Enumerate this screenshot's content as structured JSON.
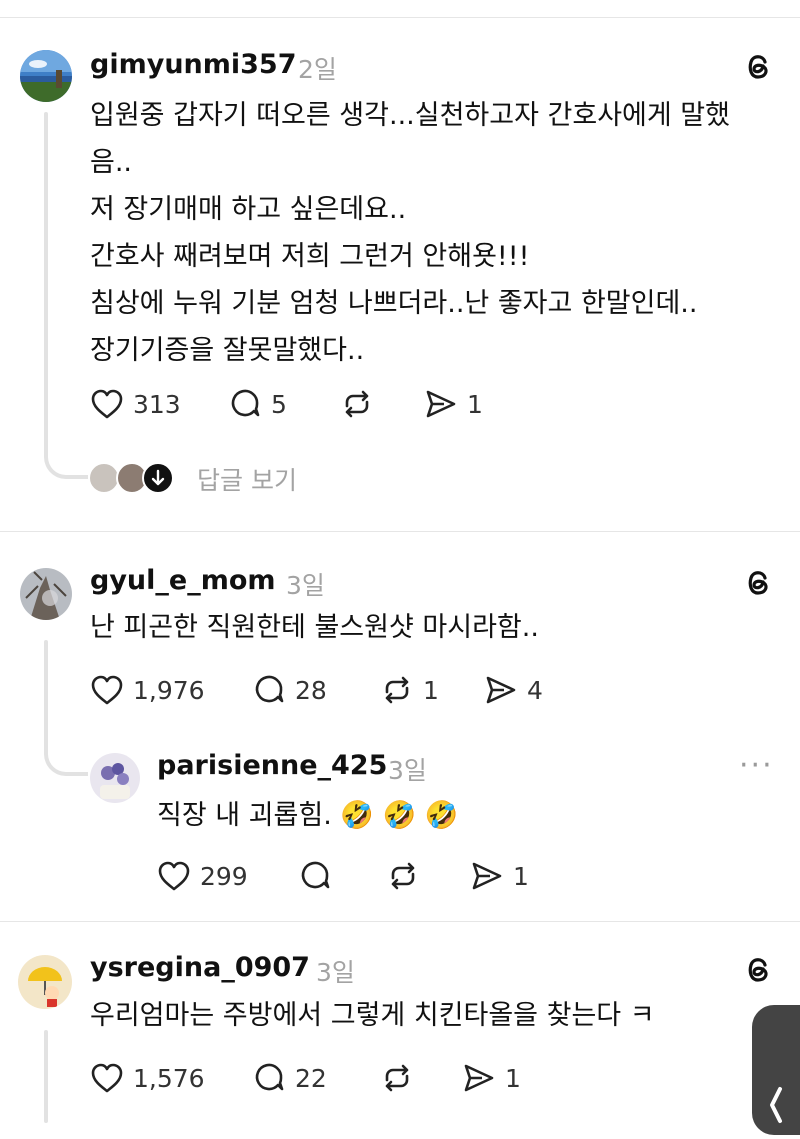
{
  "posts": [
    {
      "username": "gimyunmi357",
      "time": "2일",
      "lines": [
        "입원중 갑자기 떠오른 생각...실천하고자 간호사에게 말했",
        "음..",
        "저 장기매매 하고 싶은데요..",
        "간호사 째려보며 저희 그런거 안해욧!!!",
        "침상에 누워 기분 엄청 나쁘더라..난 좋자고 한말인데..",
        "장기기증을 잘못말했다.."
      ],
      "likes": "313",
      "comments": "5",
      "shares": "1",
      "view_replies": "답글 보기"
    },
    {
      "username": "gyul_e_mom",
      "time": "3일",
      "lines": [
        "난 피곤한 직원한테 불스원샷 마시라함.."
      ],
      "likes": "1,976",
      "comments": "28",
      "reposts": "1",
      "shares": "4"
    },
    {
      "username": "parisienne_425",
      "time": "3일",
      "lines": [
        "직장 내 괴롭힘."
      ],
      "emojis": [
        "🤣",
        "🤣",
        "🤣"
      ],
      "likes": "299",
      "shares": "1",
      "more": "···"
    },
    {
      "username": "ysregina_0907",
      "time": "3일",
      "lines": [
        "우리엄마는 주방에서 그렇게 치킨타올을 찾는다 ㅋ"
      ],
      "likes": "1,576",
      "comments": "22",
      "shares": "1"
    }
  ],
  "icons": {
    "threads": "threads-logo-icon",
    "like": "heart-icon",
    "comment": "comment-bubble-icon",
    "repost": "repost-icon",
    "share": "send-icon"
  },
  "colors": {
    "text": "#111111",
    "muted": "#a3a3a3",
    "thread_line": "#e2e2e2"
  }
}
